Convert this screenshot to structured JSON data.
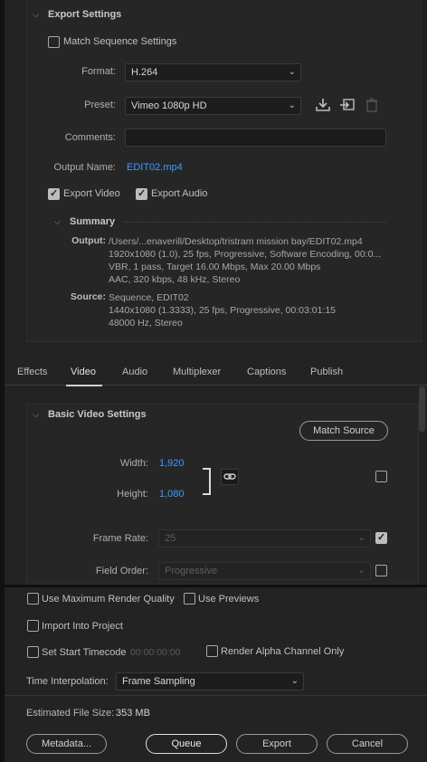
{
  "export_settings": {
    "title": "Export Settings",
    "match_sequence": {
      "label": "Match Sequence Settings",
      "checked": false
    },
    "format": {
      "label": "Format:",
      "value": "H.264"
    },
    "preset": {
      "label": "Preset:",
      "value": "Vimeo 1080p HD"
    },
    "comments": {
      "label": "Comments:",
      "value": ""
    },
    "output_name": {
      "label": "Output Name:",
      "value": "EDIT02.mp4"
    },
    "export_video": {
      "label": "Export Video",
      "checked": true
    },
    "export_audio": {
      "label": "Export Audio",
      "checked": true
    },
    "summary": {
      "title": "Summary",
      "output_label": "Output:",
      "output_lines": [
        "/Users/...enaverill/Desktop/tristram mission bay/EDIT02.mp4",
        "1920x1080 (1.0), 25 fps, Progressive, Software Encoding, 00:0...",
        "VBR, 1 pass, Target 16.00 Mbps, Max 20.00 Mbps",
        "AAC, 320 kbps, 48 kHz, Stereo"
      ],
      "source_label": "Source:",
      "source_lines": [
        "Sequence, EDIT02",
        "1440x1080 (1.3333), 25 fps, Progressive, 00:03:01:15",
        "48000 Hz, Stereo"
      ]
    }
  },
  "tabs": [
    {
      "label": "Effects",
      "active": false
    },
    {
      "label": "Video",
      "active": true
    },
    {
      "label": "Audio",
      "active": false
    },
    {
      "label": "Multiplexer",
      "active": false
    },
    {
      "label": "Captions",
      "active": false
    },
    {
      "label": "Publish",
      "active": false
    }
  ],
  "video": {
    "title": "Basic Video Settings",
    "match_source_label": "Match Source",
    "width": {
      "label": "Width:",
      "value": "1,920"
    },
    "height": {
      "label": "Height:",
      "value": "1,080"
    },
    "frame_rate": {
      "label": "Frame Rate:",
      "value": "25",
      "checked": true
    },
    "field_order": {
      "label": "Field Order:",
      "value": "Progressive",
      "checked": false
    }
  },
  "options": {
    "max_render_quality": {
      "label": "Use Maximum Render Quality",
      "checked": false
    },
    "use_previews": {
      "label": "Use Previews",
      "checked": false
    },
    "import_project": {
      "label": "Import Into Project",
      "checked": false
    },
    "set_start_timecode": {
      "label": "Set Start Timecode",
      "checked": false,
      "value": "00:00:00:00"
    },
    "render_alpha": {
      "label": "Render Alpha Channel Only",
      "checked": false
    },
    "time_interpolation": {
      "label": "Time Interpolation:",
      "value": "Frame Sampling"
    },
    "estimated_size_label": "Estimated File Size:",
    "estimated_size_value": "353 MB"
  },
  "buttons": {
    "metadata": "Metadata...",
    "queue": "Queue",
    "export": "Export",
    "cancel": "Cancel"
  },
  "colors": {
    "accent_link": "#3d9bff",
    "background": "#232323"
  }
}
